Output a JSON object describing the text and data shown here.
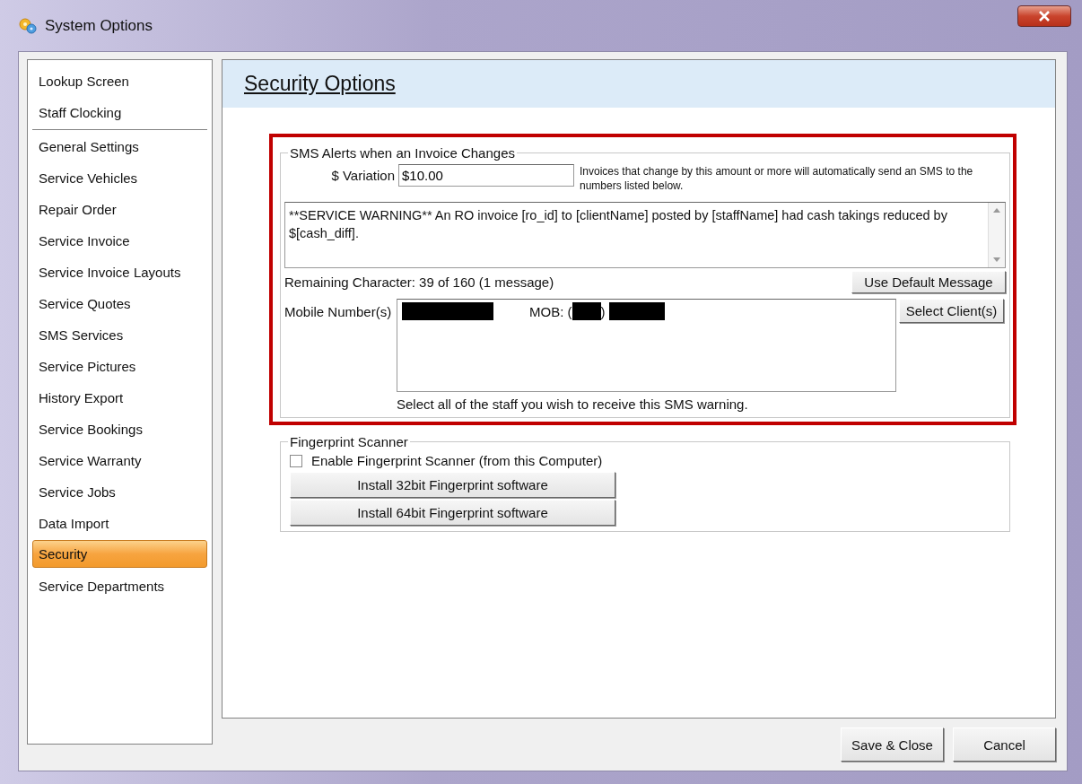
{
  "window": {
    "title": "System Options"
  },
  "sidebar": {
    "groups": [
      [
        {
          "label": "Lookup Screen",
          "selected": false
        },
        {
          "label": "Staff Clocking",
          "selected": false
        }
      ],
      [
        {
          "label": "General Settings",
          "selected": false
        },
        {
          "label": "Service Vehicles",
          "selected": false
        },
        {
          "label": "Repair Order",
          "selected": false
        },
        {
          "label": "Service Invoice",
          "selected": false
        },
        {
          "label": "Service Invoice Layouts",
          "selected": false
        },
        {
          "label": "Service Quotes",
          "selected": false
        },
        {
          "label": "SMS Services",
          "selected": false
        },
        {
          "label": "Service Pictures",
          "selected": false
        },
        {
          "label": "History Export",
          "selected": false
        },
        {
          "label": "Service Bookings",
          "selected": false
        },
        {
          "label": "Service Warranty",
          "selected": false
        },
        {
          "label": "Service Jobs",
          "selected": false
        },
        {
          "label": "Data Import",
          "selected": false
        },
        {
          "label": "Security",
          "selected": true
        },
        {
          "label": "Service Departments",
          "selected": false
        }
      ]
    ]
  },
  "panel": {
    "title": "Security Options"
  },
  "sms_alerts": {
    "highlighted": true,
    "legend": "SMS Alerts when an Invoice Changes",
    "variation_label": "$ Variation",
    "variation_value": "$10.00",
    "variation_hint": "Invoices that change by this amount or more will automatically send an SMS to the numbers listed below.",
    "message": "**SERVICE WARNING** An RO invoice [ro_id] to [clientName] posted by [staffName] had cash takings reduced by $[cash_diff].",
    "remaining": "Remaining Character: 39 of 160 (1 message)",
    "default_button": "Use Default Message",
    "mobile_label": "Mobile Number(s)",
    "mobile_entries": [
      {
        "prefix": "MOB: (",
        "suffix": ")"
      }
    ],
    "select_button": "Select Client(s)",
    "staff_hint": "Select all of the staff you wish to receive this SMS warning."
  },
  "fingerprint": {
    "legend": "Fingerprint Scanner",
    "enable": {
      "label": "Enable Fingerprint Scanner (from this Computer)",
      "checked": false
    },
    "buttons": [
      "Install 32bit Fingerprint software",
      "Install 64bit Fingerprint software"
    ]
  },
  "buttons": [
    "Save & Close",
    "Cancel"
  ]
}
